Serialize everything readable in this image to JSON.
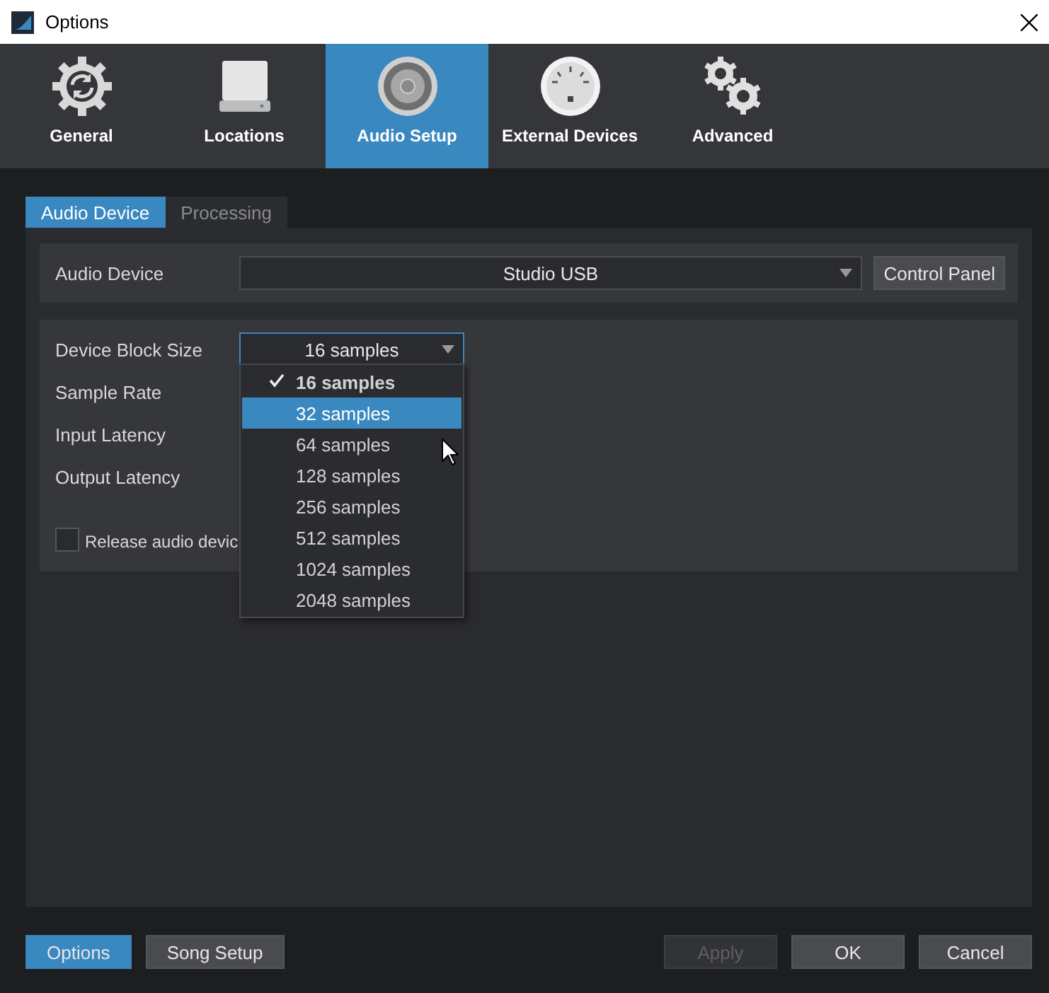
{
  "window": {
    "title": "Options"
  },
  "categories": [
    {
      "label": "General",
      "kind": "general",
      "selected": false
    },
    {
      "label": "Locations",
      "kind": "locations",
      "selected": false
    },
    {
      "label": "Audio Setup",
      "kind": "audio",
      "selected": true
    },
    {
      "label": "External Devices",
      "kind": "external",
      "selected": false
    },
    {
      "label": "Advanced",
      "kind": "advanced",
      "selected": false
    }
  ],
  "subtabs": [
    {
      "label": "Audio Device",
      "selected": true
    },
    {
      "label": "Processing",
      "selected": false
    }
  ],
  "audio_device": {
    "label": "Audio Device",
    "value": "Studio USB",
    "button": "Control Panel"
  },
  "settings": [
    {
      "label": "Device Block Size"
    },
    {
      "label": "Sample Rate"
    },
    {
      "label": "Input Latency"
    },
    {
      "label": "Output Latency"
    }
  ],
  "block_size": {
    "value": "16 samples",
    "options": [
      {
        "label": "16 samples",
        "selected": true,
        "highlighted": false
      },
      {
        "label": "32 samples",
        "selected": false,
        "highlighted": true
      },
      {
        "label": "64 samples",
        "selected": false,
        "highlighted": false
      },
      {
        "label": "128 samples",
        "selected": false,
        "highlighted": false
      },
      {
        "label": "256 samples",
        "selected": false,
        "highlighted": false
      },
      {
        "label": "512 samples",
        "selected": false,
        "highlighted": false
      },
      {
        "label": "1024 samples",
        "selected": false,
        "highlighted": false
      },
      {
        "label": "2048 samples",
        "selected": false,
        "highlighted": false
      }
    ]
  },
  "release_option": {
    "label": "Release audio devic",
    "checked": false
  },
  "footer_left": [
    {
      "label": "Options",
      "selected": true
    },
    {
      "label": "Song Setup",
      "selected": false
    }
  ],
  "footer_right": [
    {
      "label": "Apply",
      "disabled": true
    },
    {
      "label": "OK",
      "disabled": false
    },
    {
      "label": "Cancel",
      "disabled": false
    }
  ]
}
